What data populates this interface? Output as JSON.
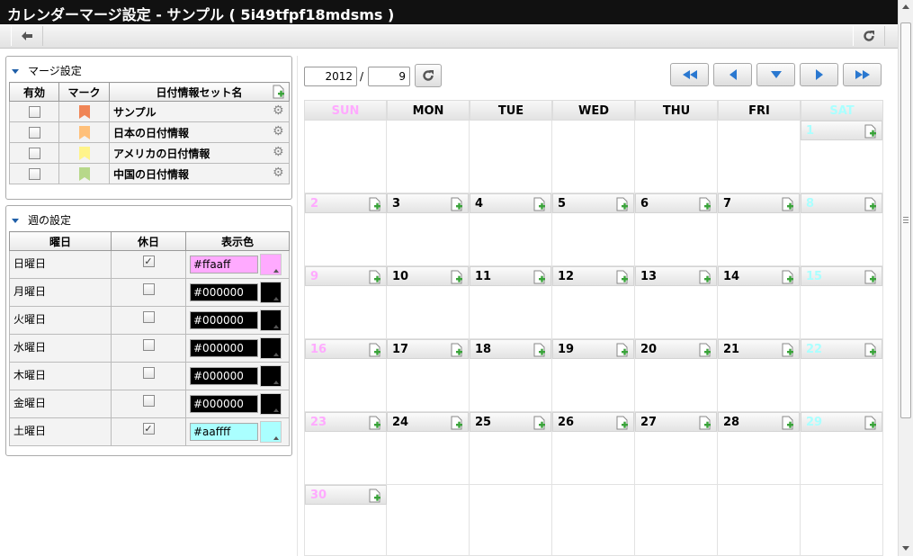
{
  "window": {
    "title": "カレンダーマージ設定 - サンプル ( 5i49tfpf18mdsms )"
  },
  "merge_panel": {
    "title": "マージ設定",
    "columns": [
      "有効",
      "マーク",
      "日付情報セット名"
    ],
    "rows": [
      {
        "enabled": false,
        "mark_color": "#f08556",
        "name": "サンプル"
      },
      {
        "enabled": false,
        "mark_color": "#ffc07a",
        "name": "日本の日付情報"
      },
      {
        "enabled": false,
        "mark_color": "#fff48a",
        "name": "アメリカの日付情報"
      },
      {
        "enabled": false,
        "mark_color": "#b7d88a",
        "name": "中国の日付情報"
      }
    ]
  },
  "week_panel": {
    "title": "週の設定",
    "columns": [
      "曜日",
      "休日",
      "表示色"
    ],
    "rows": [
      {
        "day": "日曜日",
        "holiday": true,
        "color": "#ffaaff"
      },
      {
        "day": "月曜日",
        "holiday": false,
        "color": "#000000"
      },
      {
        "day": "火曜日",
        "holiday": false,
        "color": "#000000"
      },
      {
        "day": "水曜日",
        "holiday": false,
        "color": "#000000"
      },
      {
        "day": "木曜日",
        "holiday": false,
        "color": "#000000"
      },
      {
        "day": "金曜日",
        "holiday": false,
        "color": "#000000"
      },
      {
        "day": "土曜日",
        "holiday": true,
        "color": "#aaffff"
      }
    ]
  },
  "calendar": {
    "year": "2012",
    "separator": "/",
    "month": "9",
    "weekdays": [
      "SUN",
      "MON",
      "TUE",
      "WED",
      "THU",
      "FRI",
      "SAT"
    ],
    "weekday_colors": [
      "#ffaaff",
      "#000000",
      "#000000",
      "#000000",
      "#000000",
      "#000000",
      "#aaffff"
    ],
    "weeks": [
      [
        "",
        "",
        "",
        "",
        "",
        "",
        "1"
      ],
      [
        "2",
        "3",
        "4",
        "5",
        "6",
        "7",
        "8"
      ],
      [
        "9",
        "10",
        "11",
        "12",
        "13",
        "14",
        "15"
      ],
      [
        "16",
        "17",
        "18",
        "19",
        "20",
        "21",
        "22"
      ],
      [
        "23",
        "24",
        "25",
        "26",
        "27",
        "28",
        "29"
      ],
      [
        "30",
        "",
        "",
        "",
        "",
        "",
        ""
      ]
    ]
  },
  "icons": {
    "back": "back-arrow-icon",
    "refresh": "refresh-icon",
    "add": "add-document-icon",
    "settings": "gear-icon",
    "nav": [
      "double-left-icon",
      "left-icon",
      "down-icon",
      "right-icon",
      "double-right-icon"
    ]
  }
}
